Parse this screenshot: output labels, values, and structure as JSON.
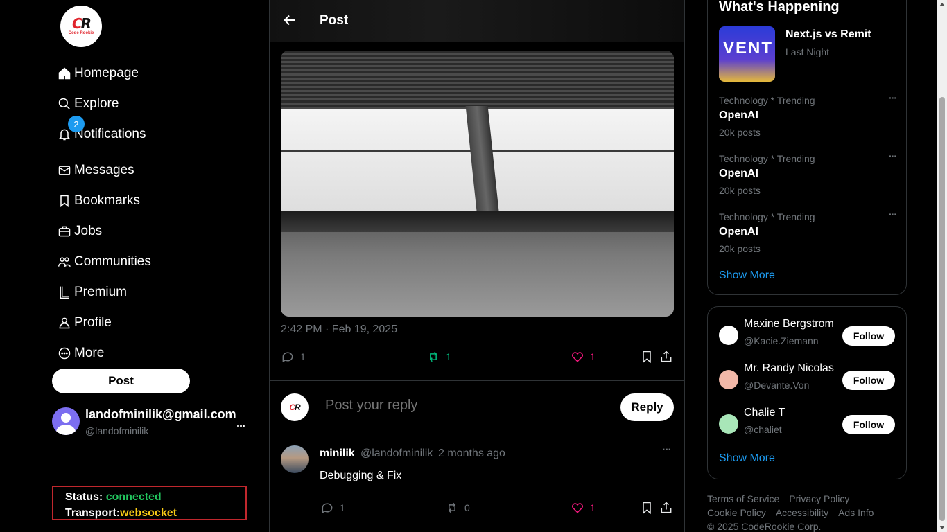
{
  "brand": {
    "logo_mark_left": "C",
    "logo_mark_right": "R",
    "logo_word": "Code Rookie"
  },
  "nav": {
    "items": [
      {
        "label": "Homepage",
        "icon": "home-icon"
      },
      {
        "label": "Explore",
        "icon": "search-icon"
      },
      {
        "label": "Notifications",
        "icon": "bell-icon"
      },
      {
        "label": "Messages",
        "icon": "mail-icon"
      },
      {
        "label": "Bookmarks",
        "icon": "bookmark-icon"
      },
      {
        "label": "Jobs",
        "icon": "briefcase-icon"
      },
      {
        "label": "Communities",
        "icon": "users-icon"
      },
      {
        "label": "Premium",
        "icon": "premium-icon"
      },
      {
        "label": "Profile",
        "icon": "user-icon"
      },
      {
        "label": "More",
        "icon": "more-circle-icon"
      }
    ],
    "notifications_badge": "2",
    "post_button": "Post"
  },
  "account": {
    "email": "landofminilik@gmail.com",
    "handle": "@landofminilik",
    "more": "..."
  },
  "status": {
    "status_label": "Status:",
    "status_value": "connected",
    "transport_label": "Transport:",
    "transport_value": "websocket"
  },
  "header": {
    "title": "Post"
  },
  "post": {
    "timestamp": "2:42 PM · Feb 19, 2025",
    "replies": "1",
    "reposts": "1",
    "likes": "1"
  },
  "reply": {
    "placeholder": "Post your reply",
    "button": "Reply"
  },
  "comment": {
    "name": "minilik",
    "handle": "@landofminilik",
    "time": "2 months ago",
    "text": "Debugging & Fix",
    "replies": "1",
    "reposts": "0",
    "likes": "1",
    "more": "···"
  },
  "happening": {
    "title": "What's Happening",
    "event": {
      "title": "Next.js vs Remit",
      "subtitle": "Last Night",
      "image_text": "VENT"
    },
    "trends": [
      {
        "category": "Technology * Trending",
        "name": "OpenAI",
        "count": "20k posts"
      },
      {
        "category": "Technology * Trending",
        "name": "OpenAI",
        "count": "20k posts"
      },
      {
        "category": "Technology * Trending",
        "name": "OpenAI",
        "count": "20k posts"
      }
    ],
    "show_more": "Show More"
  },
  "who_to_follow": {
    "users": [
      {
        "name": "Maxine Bergstrom",
        "handle": "@Kacie.Ziemann",
        "color": "#ffffff"
      },
      {
        "name": "Mr. Randy Nicolas",
        "handle": "@Devante.Von",
        "color": "#f2b8a8"
      },
      {
        "name": "Chalie T",
        "handle": "@chaliet",
        "color": "#a8e6b8"
      }
    ],
    "follow_label": "Follow",
    "show_more": "Show More"
  },
  "footer": {
    "links": [
      "Terms of Service",
      "Privacy Policy",
      "Cookie Policy",
      "Accessibility",
      "Ads Info"
    ],
    "copyright": "© 2025 CodeRookie Corp."
  }
}
